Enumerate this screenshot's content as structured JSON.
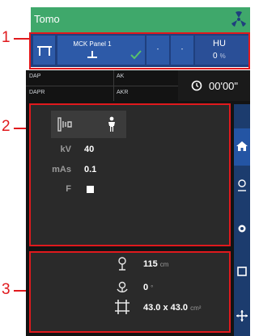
{
  "callouts": [
    "1",
    "2",
    "3"
  ],
  "header": {
    "title": "Tomo",
    "icon": "radiation-icon",
    "color": "#3fa86b"
  },
  "toolbar": {
    "panel_name": "MCK Panel 1",
    "dash1": "-",
    "dash2": "-",
    "hu_label": "HU",
    "hu_value": "0",
    "hu_unit": "%"
  },
  "dose": {
    "dap": "DAP",
    "ak": "AK",
    "dapr": "DAPR",
    "akr": "AKR"
  },
  "timer": {
    "value": "00'00\""
  },
  "exposure": {
    "kv_label": "kV",
    "kv_value": "40",
    "mas_label": "mAs",
    "mas_value": "0.1",
    "f_label": "F"
  },
  "geometry": {
    "distance_value": "115",
    "distance_unit": "cm",
    "angle_value": "0",
    "angle_unit": "°",
    "field_value": "43.0 x 43.0",
    "field_unit": "cm²"
  },
  "sidenav": [
    "home-icon",
    "person-outline-icon",
    "eye-icon",
    "square-icon",
    "move-icon"
  ],
  "colors": {
    "accent_red": "#e0191d",
    "toolbar_blue": "#1f3f7e",
    "check_green": "#57c26b"
  }
}
